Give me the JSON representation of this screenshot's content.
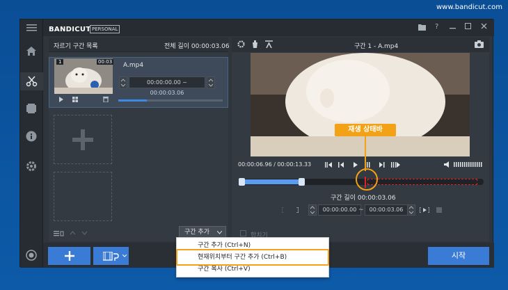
{
  "website": "www.bandicut.com",
  "app": {
    "logo_part1": "BANDI",
    "logo_part2": "CUT",
    "edition": "PERSONAL"
  },
  "left_panel": {
    "title": "자르기 구간 목록",
    "total_length_label": "전체 길이 00:00:03.06",
    "clip": {
      "index": "1",
      "duration": "00:03",
      "filename": "A.mp4",
      "range": "00:00:00.00 ~ 00:00:03.06",
      "progress": 0.27
    },
    "add_segment_button": "구간 추가"
  },
  "right_panel": {
    "title": "구간 1 - A.mp4",
    "time_display": "00:00:06.96 / 00:00:13.33",
    "segment_length": "구간 길이 00:00:03.06",
    "start_time": "00:00:00.00",
    "range_sep": "~",
    "end_time": "00:00:03.06",
    "merge_label": "합치기",
    "callout": "재생 상태바"
  },
  "dropdown_menu": {
    "items": [
      "구간 추가 (Ctrl+N)",
      "현재위치부터 구간 추가 (Ctrl+B)",
      "구간 복사 (Ctrl+V)"
    ],
    "highlighted_index": 1
  },
  "bottom_bar": {
    "start_button": "시작"
  },
  "colors": {
    "accent_blue": "#3a7bd5",
    "highlight_orange": "#f3a116",
    "panel_bg": "#343a41",
    "cut_region_red": "#e02424"
  }
}
